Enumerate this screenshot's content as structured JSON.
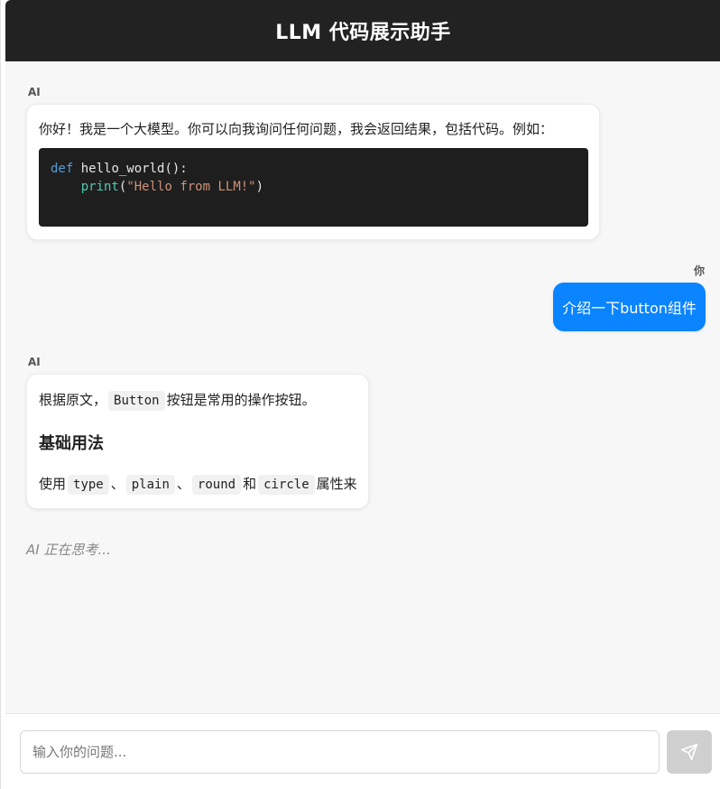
{
  "header": {
    "title": "LLM 代码展示助手"
  },
  "messages": {
    "m1": {
      "sender": "AI",
      "text": "你好！我是一个大模型。你可以向我询问任何问题，我会返回结果，包括代码。例如：",
      "code": {
        "line1_kw": "def",
        "line1_rest": " hello_world():",
        "line2_indent": "    ",
        "line2_fn": "print",
        "line2_open": "(",
        "line2_str": "\"Hello from LLM!\"",
        "line2_close": ")"
      }
    },
    "m2": {
      "sender": "你",
      "text": "介绍一下button组件"
    },
    "m3": {
      "sender": "AI",
      "line1_prefix": "根据原文，",
      "line1_code": "Button",
      "line1_suffix": "按钮是常用的操作按钮。",
      "heading": "基础用法",
      "line2_prefix": "使用",
      "code_type": "type",
      "sep1": "、",
      "code_plain": "plain",
      "sep2": "、",
      "code_round": "round",
      "and_word": "和",
      "code_circle": "circle",
      "line2_suffix": "属性来"
    }
  },
  "status": {
    "thinking": "AI 正在思考..."
  },
  "input": {
    "placeholder": "输入你的问题..."
  },
  "icons": {
    "send": "send-icon"
  },
  "colors": {
    "header_bg": "#222222",
    "user_bubble": "#0a84ff",
    "code_bg": "#1e1e1e",
    "send_button_bg": "#cfcfcf"
  }
}
